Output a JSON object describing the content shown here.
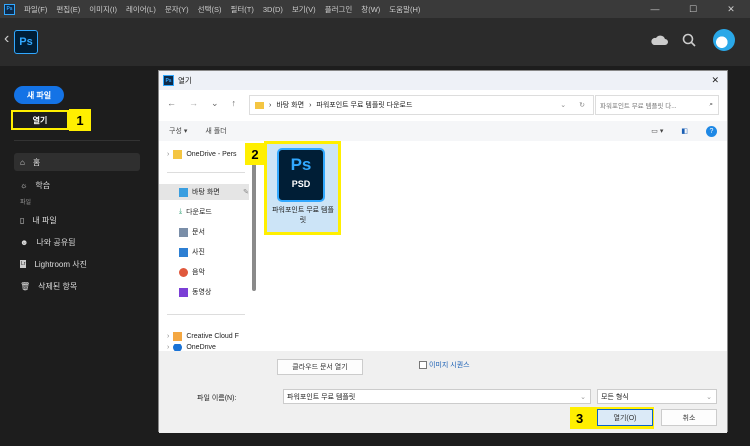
{
  "menubar": {
    "items": [
      "파일(F)",
      "편집(E)",
      "이미지(I)",
      "레이어(L)",
      "문자(Y)",
      "선택(S)",
      "필터(T)",
      "3D(D)",
      "보기(V)",
      "플러그인",
      "창(W)",
      "도움말(H)"
    ]
  },
  "app": {
    "logo": "Ps",
    "back": "‹"
  },
  "window_controls": {
    "minimize": "—",
    "maximize": "☐",
    "close": "✕"
  },
  "sidebar": {
    "new_file": "새 파일",
    "open": "열기",
    "badge1": "1",
    "home": "홈",
    "learn": "학습",
    "section_files": "파일",
    "my_files": "내 파일",
    "shared": "나와 공유됨",
    "lightroom": "Lightroom 사진",
    "deleted": "삭제된 항목"
  },
  "dialog": {
    "title": "열기",
    "close": "✕",
    "breadcrumb": [
      "바탕 화면",
      "파워포인트 무료 템플릿 다운로드"
    ],
    "search_placeholder": "파워포인트 무료 템플릿 다...",
    "toolbar": {
      "organize": "구성 ▾",
      "new_folder": "새 폴더"
    },
    "nav_items": [
      "OneDrive - Pers",
      "바탕 화면",
      "다운로드",
      "문서",
      "사진",
      "음악",
      "동영상",
      "Creative Cloud F",
      "OneDrive"
    ],
    "file": {
      "icon_label": "Ps",
      "ext": "PSD",
      "name": "파워포인트 무료 템플릿"
    },
    "badge2": "2",
    "cloud_button": "클라우드 문서 열기",
    "image_sequence": "이미지 시퀀스",
    "filename_label": "파일 이름(N):",
    "filename_value": "파워포인트 무료 템플릿",
    "filetype": "모든 형식",
    "open_button": "열기(O)",
    "cancel_button": "취소",
    "badge3": "3"
  }
}
